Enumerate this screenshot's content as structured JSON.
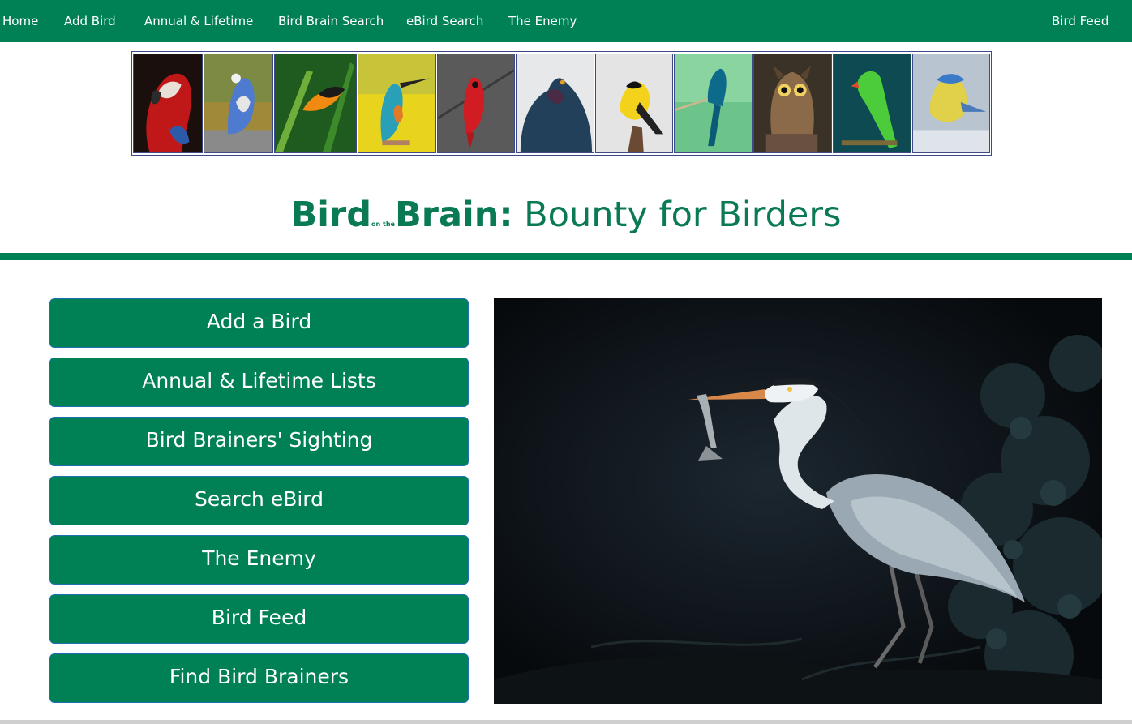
{
  "nav": {
    "items": [
      "Home",
      "Add Bird",
      "Annual & Lifetime",
      "Bird Brain Search",
      "eBird Search",
      "The Enemy"
    ],
    "right_item": "Bird Feed"
  },
  "banner": {
    "thumbnails": [
      "scarlet-macaw",
      "blue-jay",
      "oriole",
      "kingfisher",
      "cardinal",
      "pigeon",
      "goldfinch",
      "drongo",
      "great-horned-owl",
      "green-parakeet",
      "blue-tit"
    ]
  },
  "title": {
    "part1": "Bird",
    "small": "on the",
    "part2": "Brain:",
    "part3": " Bounty for Birders"
  },
  "menu": [
    "Add a Bird",
    "Annual & Lifetime Lists",
    "Bird Brainers' Sighting",
    "Search eBird",
    "The Enemy",
    "Bird Feed",
    "Find Bird Brainers"
  ],
  "colors": {
    "brand_green": "#008055",
    "title_green": "#0a7a55",
    "button_border": "#1f6fb0"
  }
}
